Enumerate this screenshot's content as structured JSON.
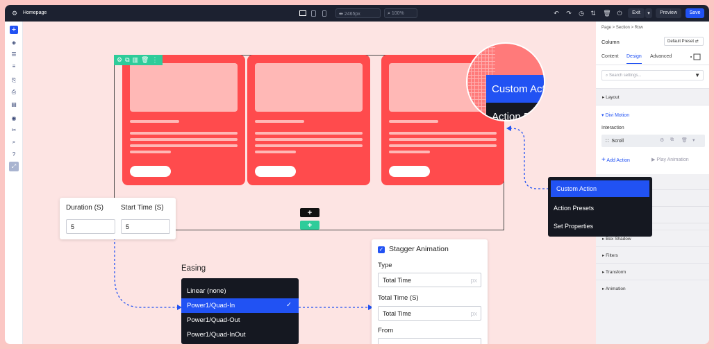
{
  "topbar": {
    "page_name": "Homepage",
    "width_value": "2465px",
    "zoom_value": "100%",
    "exit_label": "Exit",
    "preview_label": "Preview",
    "save_label": "Save"
  },
  "magnifier": {
    "item1": "Custom Action",
    "item2": "Action Presets"
  },
  "timing": {
    "duration_label": "Duration (S)",
    "start_label": "Start Time (S)",
    "duration_value": "5",
    "start_value": "5"
  },
  "easing": {
    "title": "Easing",
    "options": [
      "Linear (none)",
      "Power1/Quad-In",
      "Power1/Quad-Out",
      "Power1/Quad-InOut"
    ],
    "selected_index": 1
  },
  "stagger": {
    "checkbox_label": "Stagger Animation",
    "checked": true,
    "type_label": "Type",
    "type_value": "Total Time",
    "type_unit": "px",
    "total_label": "Total Time (S)",
    "total_value": "Total Time",
    "total_unit": "px",
    "from_label": "From"
  },
  "action_menu": {
    "items": [
      "Custom Action",
      "Action Presets",
      "Set Properties"
    ],
    "selected_index": 0
  },
  "panel": {
    "breadcrumb": "Page > Section > Row",
    "module_name": "Column",
    "preset_label": "Default Preset",
    "tabs": [
      "Content",
      "Design",
      "Advanced"
    ],
    "active_tab": "Design",
    "search_placeholder": "Search settings...",
    "layout_label": "Layout",
    "motion_label": "Divi Motion",
    "interaction_label": "Interaction",
    "scroll_label": "Scroll",
    "add_action_label": "Add Action",
    "play_label": "Play Animation",
    "box_shadow_label": "Box Shadow",
    "filters_label": "Filters",
    "transform_label": "Transform",
    "animation_label": "Animation"
  },
  "colors": {
    "accent": "#2152f3",
    "card_red": "#ff4b4d",
    "green": "#2ecc9a",
    "dark": "#1c2130"
  }
}
